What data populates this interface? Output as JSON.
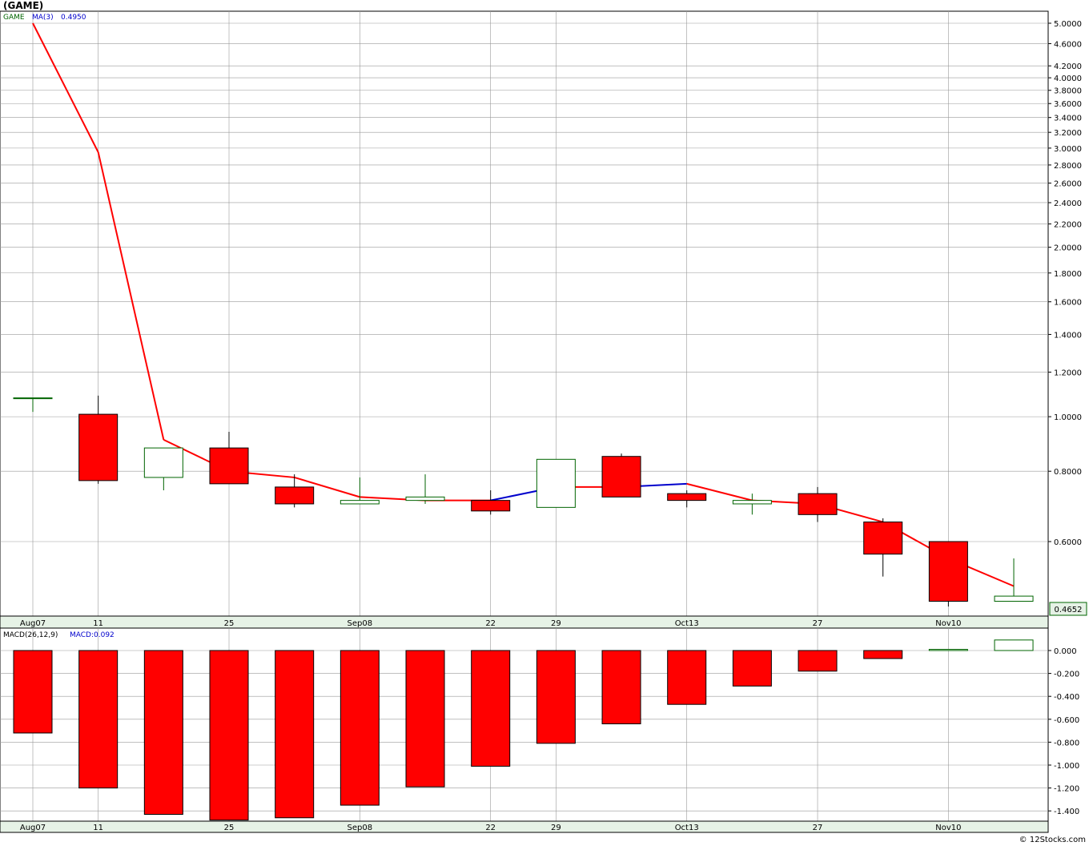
{
  "title": "(GAME)",
  "credit": "© 12Stocks.com",
  "price_panel": {
    "legend": [
      {
        "text": "GAME",
        "color": "#006400"
      },
      {
        "text": "MA(3)",
        "color": "#0000cc"
      },
      {
        "text": "0.4950",
        "color": "#0000cc"
      }
    ],
    "y_ticks": [
      "5.0000",
      "4.6000",
      "4.2000",
      "4.0000",
      "3.8000",
      "3.6000",
      "3.4000",
      "3.2000",
      "3.0000",
      "2.8000",
      "2.6000",
      "2.4000",
      "2.2000",
      "2.0000",
      "1.8000",
      "1.6000",
      "1.4000",
      "1.2000",
      "1.0000",
      "0.8000",
      "0.6000"
    ],
    "last_price_label": "0.4652"
  },
  "macd_panel": {
    "legend": [
      {
        "text": "MACD(26,12,9)",
        "color": "#000000"
      },
      {
        "text": "MACD:0.092",
        "color": "#0000cc"
      }
    ],
    "y_ticks": [
      "0.000",
      "-0.200",
      "-0.400",
      "-0.600",
      "-0.800",
      "-1.000",
      "-1.200",
      "-1.400"
    ]
  },
  "x_labels": [
    {
      "text": "Aug07",
      "i": 0
    },
    {
      "text": "11",
      "i": 1
    },
    {
      "text": "25",
      "i": 3
    },
    {
      "text": "Sep08",
      "i": 5
    },
    {
      "text": "22",
      "i": 7
    },
    {
      "text": "29",
      "i": 8
    },
    {
      "text": "Oct13",
      "i": 10
    },
    {
      "text": "27",
      "i": 12
    },
    {
      "text": "Nov10",
      "i": 14
    }
  ],
  "colors": {
    "up": "#006400",
    "down": "#ff0000",
    "ma_down": "#ff0000",
    "ma_up": "#0000cc",
    "grid": "#9a9a9a",
    "axis_band": "#e6f2e6"
  },
  "chart_data": [
    {
      "type": "candlestick",
      "title": "(GAME)",
      "y_scale": "log",
      "ylim": [
        0.46,
        5.1
      ],
      "candles": [
        {
          "open": 1.08,
          "high": 1.08,
          "low": 1.02,
          "close": 1.08
        },
        {
          "open": 1.01,
          "high": 1.09,
          "low": 0.76,
          "close": 0.77
        },
        {
          "open": 0.78,
          "high": 0.88,
          "low": 0.74,
          "close": 0.88
        },
        {
          "open": 0.88,
          "high": 0.94,
          "low": 0.76,
          "close": 0.76
        },
        {
          "open": 0.75,
          "high": 0.79,
          "low": 0.69,
          "close": 0.7
        },
        {
          "open": 0.7,
          "high": 0.78,
          "low": 0.7,
          "close": 0.71
        },
        {
          "open": 0.71,
          "high": 0.79,
          "low": 0.7,
          "close": 0.72
        },
        {
          "open": 0.71,
          "high": 0.74,
          "low": 0.67,
          "close": 0.68
        },
        {
          "open": 0.69,
          "high": 0.84,
          "low": 0.69,
          "close": 0.84
        },
        {
          "open": 0.85,
          "high": 0.86,
          "low": 0.72,
          "close": 0.72
        },
        {
          "open": 0.73,
          "high": 0.74,
          "low": 0.69,
          "close": 0.71
        },
        {
          "open": 0.7,
          "high": 0.73,
          "low": 0.67,
          "close": 0.71
        },
        {
          "open": 0.73,
          "high": 0.75,
          "low": 0.65,
          "close": 0.67
        },
        {
          "open": 0.65,
          "high": 0.66,
          "low": 0.52,
          "close": 0.57
        },
        {
          "open": 0.6,
          "high": 0.6,
          "low": 0.46,
          "close": 0.47
        },
        {
          "open": 0.47,
          "high": 0.56,
          "low": 0.47,
          "close": 0.48
        }
      ],
      "series": [
        {
          "name": "MA(3)",
          "values": [
            5.0,
            2.95,
            0.91,
            0.8,
            0.78,
            0.72,
            0.71,
            0.71,
            0.75,
            0.75,
            0.76,
            0.71,
            0.7,
            0.65,
            0.56,
            0.5
          ]
        }
      ]
    },
    {
      "type": "bar",
      "title": "MACD(26,12,9)",
      "ylim": [
        -1.48,
        0.13
      ],
      "values": [
        -0.72,
        -1.2,
        -1.43,
        -1.48,
        -1.46,
        -1.35,
        -1.19,
        -1.01,
        -0.81,
        -0.64,
        -0.47,
        -0.31,
        -0.18,
        -0.07,
        0.01,
        0.092
      ]
    }
  ]
}
